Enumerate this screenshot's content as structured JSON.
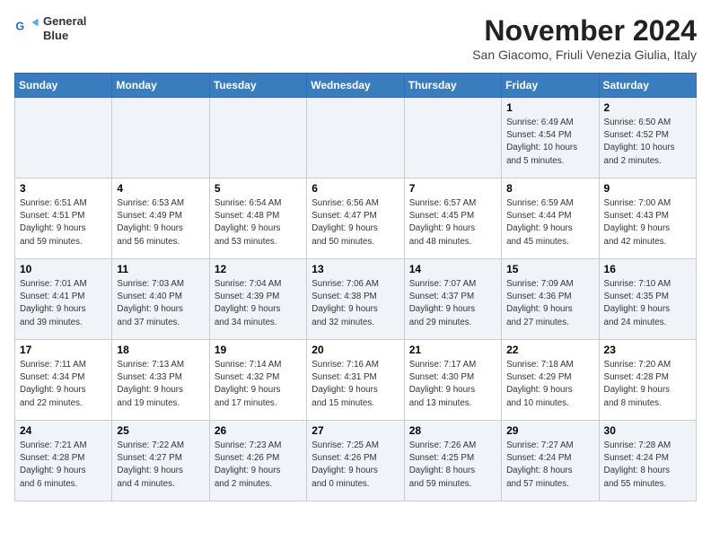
{
  "logo": {
    "line1": "General",
    "line2": "Blue"
  },
  "title": "November 2024",
  "subtitle": "San Giacomo, Friuli Venezia Giulia, Italy",
  "weekdays": [
    "Sunday",
    "Monday",
    "Tuesday",
    "Wednesday",
    "Thursday",
    "Friday",
    "Saturday"
  ],
  "weeks": [
    [
      {
        "day": "",
        "info": ""
      },
      {
        "day": "",
        "info": ""
      },
      {
        "day": "",
        "info": ""
      },
      {
        "day": "",
        "info": ""
      },
      {
        "day": "",
        "info": ""
      },
      {
        "day": "1",
        "info": "Sunrise: 6:49 AM\nSunset: 4:54 PM\nDaylight: 10 hours\nand 5 minutes."
      },
      {
        "day": "2",
        "info": "Sunrise: 6:50 AM\nSunset: 4:52 PM\nDaylight: 10 hours\nand 2 minutes."
      }
    ],
    [
      {
        "day": "3",
        "info": "Sunrise: 6:51 AM\nSunset: 4:51 PM\nDaylight: 9 hours\nand 59 minutes."
      },
      {
        "day": "4",
        "info": "Sunrise: 6:53 AM\nSunset: 4:49 PM\nDaylight: 9 hours\nand 56 minutes."
      },
      {
        "day": "5",
        "info": "Sunrise: 6:54 AM\nSunset: 4:48 PM\nDaylight: 9 hours\nand 53 minutes."
      },
      {
        "day": "6",
        "info": "Sunrise: 6:56 AM\nSunset: 4:47 PM\nDaylight: 9 hours\nand 50 minutes."
      },
      {
        "day": "7",
        "info": "Sunrise: 6:57 AM\nSunset: 4:45 PM\nDaylight: 9 hours\nand 48 minutes."
      },
      {
        "day": "8",
        "info": "Sunrise: 6:59 AM\nSunset: 4:44 PM\nDaylight: 9 hours\nand 45 minutes."
      },
      {
        "day": "9",
        "info": "Sunrise: 7:00 AM\nSunset: 4:43 PM\nDaylight: 9 hours\nand 42 minutes."
      }
    ],
    [
      {
        "day": "10",
        "info": "Sunrise: 7:01 AM\nSunset: 4:41 PM\nDaylight: 9 hours\nand 39 minutes."
      },
      {
        "day": "11",
        "info": "Sunrise: 7:03 AM\nSunset: 4:40 PM\nDaylight: 9 hours\nand 37 minutes."
      },
      {
        "day": "12",
        "info": "Sunrise: 7:04 AM\nSunset: 4:39 PM\nDaylight: 9 hours\nand 34 minutes."
      },
      {
        "day": "13",
        "info": "Sunrise: 7:06 AM\nSunset: 4:38 PM\nDaylight: 9 hours\nand 32 minutes."
      },
      {
        "day": "14",
        "info": "Sunrise: 7:07 AM\nSunset: 4:37 PM\nDaylight: 9 hours\nand 29 minutes."
      },
      {
        "day": "15",
        "info": "Sunrise: 7:09 AM\nSunset: 4:36 PM\nDaylight: 9 hours\nand 27 minutes."
      },
      {
        "day": "16",
        "info": "Sunrise: 7:10 AM\nSunset: 4:35 PM\nDaylight: 9 hours\nand 24 minutes."
      }
    ],
    [
      {
        "day": "17",
        "info": "Sunrise: 7:11 AM\nSunset: 4:34 PM\nDaylight: 9 hours\nand 22 minutes."
      },
      {
        "day": "18",
        "info": "Sunrise: 7:13 AM\nSunset: 4:33 PM\nDaylight: 9 hours\nand 19 minutes."
      },
      {
        "day": "19",
        "info": "Sunrise: 7:14 AM\nSunset: 4:32 PM\nDaylight: 9 hours\nand 17 minutes."
      },
      {
        "day": "20",
        "info": "Sunrise: 7:16 AM\nSunset: 4:31 PM\nDaylight: 9 hours\nand 15 minutes."
      },
      {
        "day": "21",
        "info": "Sunrise: 7:17 AM\nSunset: 4:30 PM\nDaylight: 9 hours\nand 13 minutes."
      },
      {
        "day": "22",
        "info": "Sunrise: 7:18 AM\nSunset: 4:29 PM\nDaylight: 9 hours\nand 10 minutes."
      },
      {
        "day": "23",
        "info": "Sunrise: 7:20 AM\nSunset: 4:28 PM\nDaylight: 9 hours\nand 8 minutes."
      }
    ],
    [
      {
        "day": "24",
        "info": "Sunrise: 7:21 AM\nSunset: 4:28 PM\nDaylight: 9 hours\nand 6 minutes."
      },
      {
        "day": "25",
        "info": "Sunrise: 7:22 AM\nSunset: 4:27 PM\nDaylight: 9 hours\nand 4 minutes."
      },
      {
        "day": "26",
        "info": "Sunrise: 7:23 AM\nSunset: 4:26 PM\nDaylight: 9 hours\nand 2 minutes."
      },
      {
        "day": "27",
        "info": "Sunrise: 7:25 AM\nSunset: 4:26 PM\nDaylight: 9 hours\nand 0 minutes."
      },
      {
        "day": "28",
        "info": "Sunrise: 7:26 AM\nSunset: 4:25 PM\nDaylight: 8 hours\nand 59 minutes."
      },
      {
        "day": "29",
        "info": "Sunrise: 7:27 AM\nSunset: 4:24 PM\nDaylight: 8 hours\nand 57 minutes."
      },
      {
        "day": "30",
        "info": "Sunrise: 7:28 AM\nSunset: 4:24 PM\nDaylight: 8 hours\nand 55 minutes."
      }
    ]
  ]
}
